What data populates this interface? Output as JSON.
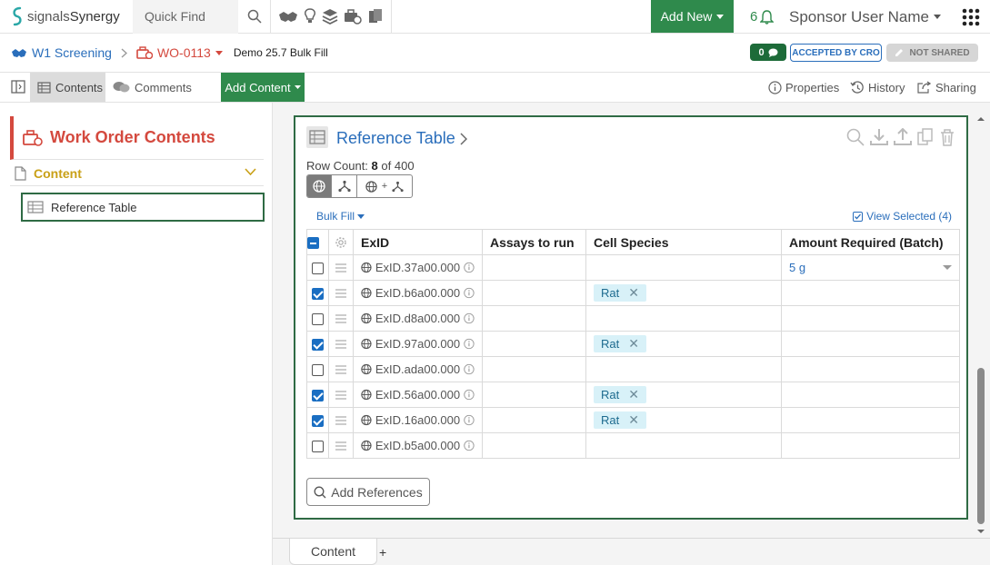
{
  "app": {
    "brand_prefix": "signals",
    "brand_name": "Synergy",
    "quick_find": "Quick Find",
    "add_new": "Add New",
    "notification_count": "6",
    "user_name": "Sponsor User Name"
  },
  "breadcrumb": {
    "items": [
      {
        "label": "W1 Screening"
      },
      {
        "label": "WO-0113"
      }
    ],
    "title": "Demo 25.7 Bulk Fill",
    "comment_count": "0",
    "status_badge": "ACCEPTED BY CRO",
    "sharing_badge": "NOT SHARED"
  },
  "toolbar": {
    "contents": "Contents",
    "comments": "Comments",
    "add_content": "Add Content",
    "properties": "Properties",
    "history": "History",
    "sharing": "Sharing"
  },
  "sidebar": {
    "title": "Work Order Contents",
    "section": "Content",
    "items": [
      {
        "label": "Reference Table"
      }
    ]
  },
  "card": {
    "title": "Reference Table",
    "row_count_label": "Row Count:",
    "row_count": "8",
    "row_count_of": "of 400",
    "bulk_fill": "Bulk Fill",
    "view_selected": "View Selected (4)",
    "columns": [
      "ExID",
      "Assays to run",
      "Cell Species",
      "Amount Required (Batch)"
    ],
    "rows": [
      {
        "checked": false,
        "exid": "ExID.37a00.000",
        "assays": "",
        "species": "",
        "amount": "5 g"
      },
      {
        "checked": true,
        "exid": "ExID.b6a00.000",
        "assays": "",
        "species": "Rat",
        "amount": ""
      },
      {
        "checked": false,
        "exid": "ExID.d8a00.000",
        "assays": "",
        "species": "",
        "amount": ""
      },
      {
        "checked": true,
        "exid": "ExID.97a00.000",
        "assays": "",
        "species": "Rat",
        "amount": ""
      },
      {
        "checked": false,
        "exid": "ExID.ada00.000",
        "assays": "",
        "species": "",
        "amount": ""
      },
      {
        "checked": true,
        "exid": "ExID.56a00.000",
        "assays": "",
        "species": "Rat",
        "amount": ""
      },
      {
        "checked": true,
        "exid": "ExID.16a00.000",
        "assays": "",
        "species": "Rat",
        "amount": ""
      },
      {
        "checked": false,
        "exid": "ExID.b5a00.000",
        "assays": "",
        "species": "",
        "amount": ""
      }
    ],
    "add_references": "Add References"
  },
  "bottom_tabs": {
    "active": "Content",
    "add": "+"
  },
  "colors": {
    "brand_green": "#2f8a4c",
    "link_blue": "#2a6ebb",
    "work_order_red": "#d4493e",
    "content_gold": "#c9a017",
    "chip_bg": "#d8f1f8"
  }
}
